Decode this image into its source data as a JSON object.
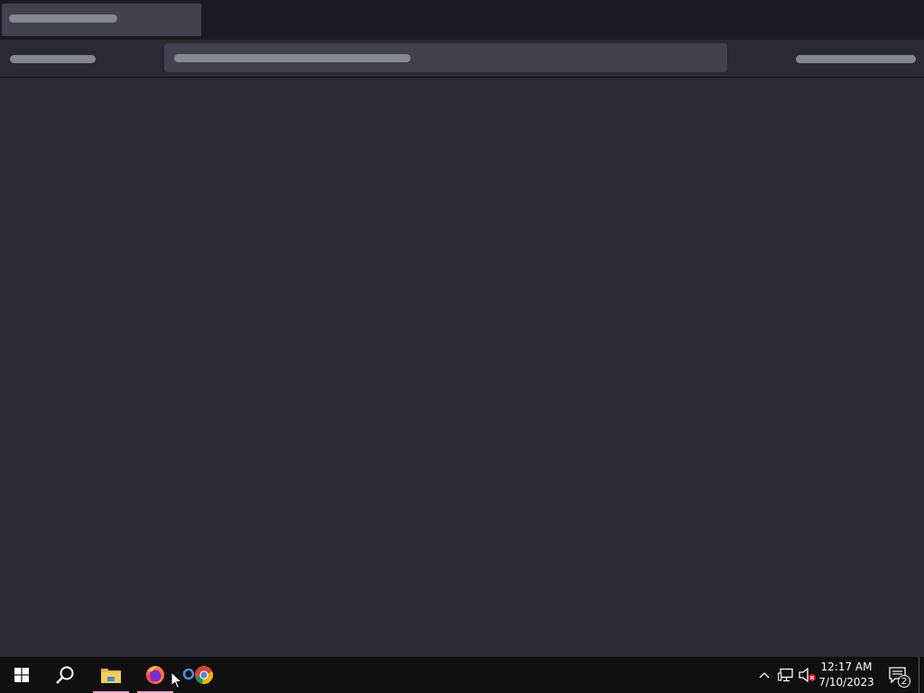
{
  "browser": {
    "theme": {
      "background": "#2b2a33",
      "tabstrip": "#1c1b22",
      "tab_active": "#42414d",
      "placeholder": "#8f8f9d"
    }
  },
  "taskbar": {
    "pinned": [
      {
        "name": "start-button",
        "icon": "windows-logo-icon"
      },
      {
        "name": "search-button",
        "icon": "search-icon"
      },
      {
        "name": "file-explorer",
        "icon": "folder-icon",
        "active": true
      },
      {
        "name": "firefox",
        "icon": "firefox-icon",
        "active": true
      },
      {
        "name": "chrome",
        "icon": "chrome-icon",
        "active": false
      }
    ],
    "tray": {
      "time": "12:17 AM",
      "date": "7/10/2023",
      "notification_count": "2"
    },
    "accent": "#f29ec7"
  }
}
